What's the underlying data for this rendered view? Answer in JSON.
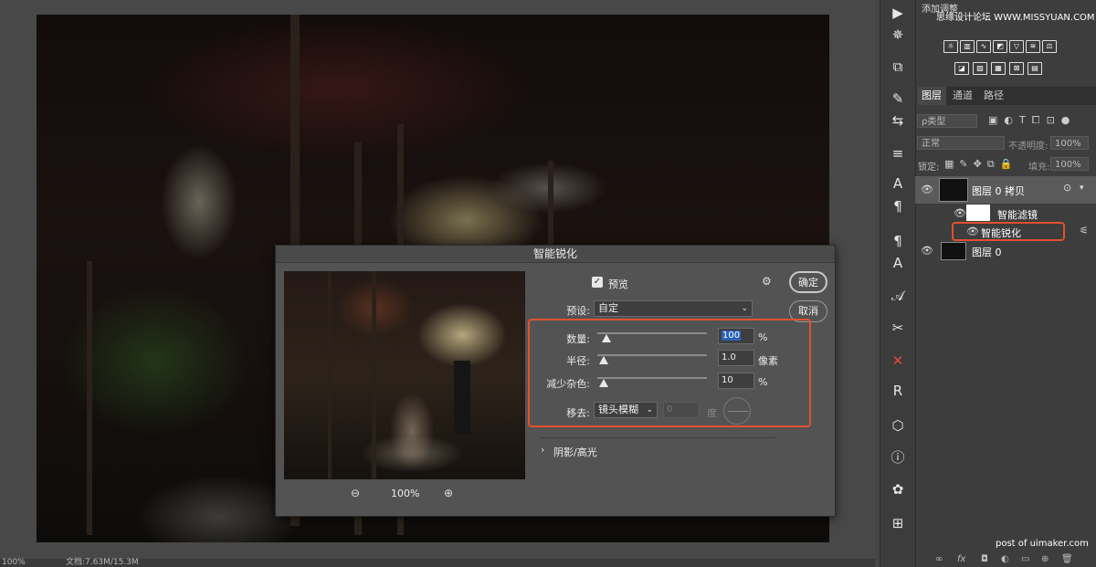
{
  "canvas": {
    "status_zoom": "100%",
    "status_doc": "文档:7.63M/15.3M"
  },
  "tools": [
    {
      "name": "play-icon",
      "glyph": "▶"
    },
    {
      "name": "compass-icon",
      "glyph": "✵"
    },
    {
      "name": "transform-icon",
      "glyph": "⧉"
    },
    {
      "name": "brush-icon",
      "glyph": "✎"
    },
    {
      "name": "adjust-icon",
      "glyph": "⇆"
    },
    {
      "name": "align-icon",
      "glyph": "≡"
    },
    {
      "name": "character-icon",
      "glyph": "A"
    },
    {
      "name": "paragraph-icon",
      "glyph": "¶"
    },
    {
      "name": "paragraph-style-icon",
      "glyph": "¶"
    },
    {
      "name": "character-style-icon",
      "glyph": "A"
    },
    {
      "name": "glyphs-icon",
      "glyph": "𝒜"
    },
    {
      "name": "tools-icon",
      "glyph": "✂"
    },
    {
      "name": "smart-sharpen-tool-icon",
      "glyph": "✕"
    },
    {
      "name": "plugin-r-icon",
      "glyph": "R"
    },
    {
      "name": "3d-icon",
      "glyph": "⬡"
    },
    {
      "name": "info-icon",
      "glyph": "ⓘ"
    },
    {
      "name": "palette-icon",
      "glyph": "✿"
    },
    {
      "name": "grid-icon",
      "glyph": "⊞"
    }
  ],
  "adjustments": {
    "title": "添加调整"
  },
  "watermark": {
    "top": "思缘设计论坛 WWW.MISSYUAN.COM",
    "bottom": "post of uimaker.com"
  },
  "panel_tabs": [
    {
      "label": "图层",
      "active": true
    },
    {
      "label": "通道",
      "active": false
    },
    {
      "label": "路径",
      "active": false
    }
  ],
  "layers_panel": {
    "filter_label": "ρ类型",
    "blend_mode": "正常",
    "opacity_label": "不透明度:",
    "opacity_value": "100%",
    "lock_label": "锁定:",
    "fill_label": "填充:",
    "fill_value": "100%"
  },
  "layers": [
    {
      "name": "图层 0 拷贝"
    },
    {
      "name": "智能滤镜"
    },
    {
      "name": "智能锐化"
    },
    {
      "name": "图层 0"
    }
  ],
  "dialog": {
    "title": "智能锐化",
    "preview_label": "预览",
    "preview_checked": true,
    "ok": "确定",
    "cancel": "取消",
    "preset_label": "预设:",
    "preset_value": "自定",
    "amount_label": "数量:",
    "amount_value": "100",
    "amount_unit": "%",
    "amount_fraction": 0.08,
    "radius_label": "半径:",
    "radius_value": "1.0",
    "radius_unit": "像素",
    "radius_fraction": 0.06,
    "noise_label": "减少杂色:",
    "noise_value": "10",
    "noise_unit": "%",
    "noise_fraction": 0.06,
    "remove_label": "移去:",
    "remove_value": "镜头模糊",
    "angle_value": "0",
    "angle_unit": "度",
    "shadow_label": "阴影/高光",
    "zoom": "100%"
  },
  "colors": {
    "highlight": "#e2502f",
    "selection": "#2a62b8"
  }
}
